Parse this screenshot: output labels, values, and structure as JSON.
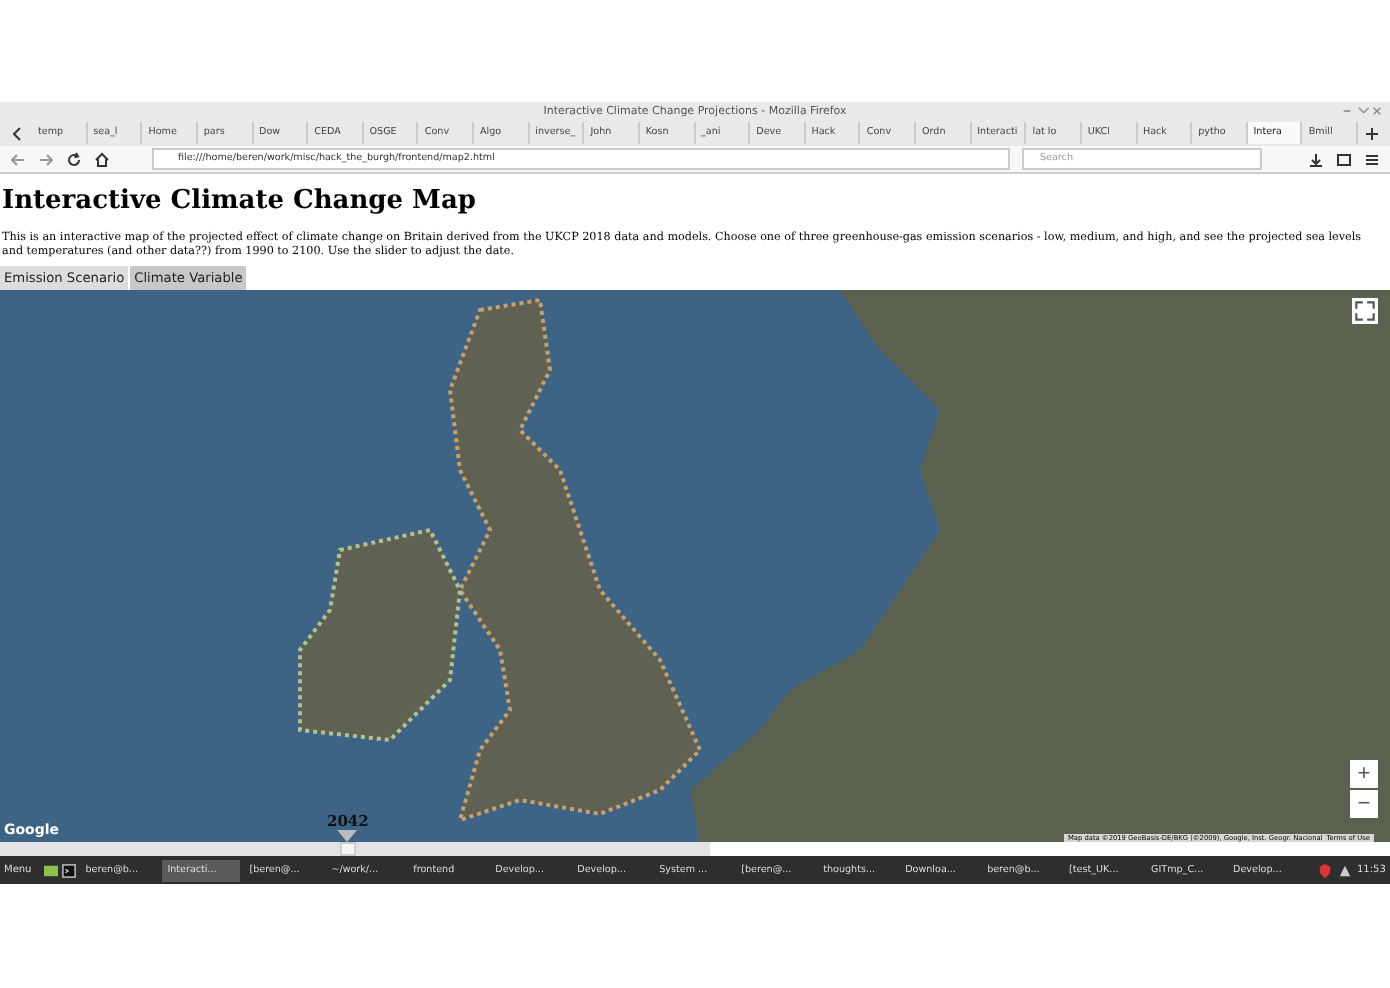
{
  "window": {
    "title": "Interactive Climate Change Projections - Mozilla Firefox"
  },
  "browser_tabs": [
    {
      "label": "temp",
      "selected": false
    },
    {
      "label": "sea_l",
      "selected": false
    },
    {
      "label": "Home",
      "selected": false
    },
    {
      "label": "pars",
      "selected": false
    },
    {
      "label": "Dow",
      "selected": false
    },
    {
      "label": "CEDA",
      "selected": false
    },
    {
      "label": "OSGE",
      "selected": false
    },
    {
      "label": "Conv",
      "selected": false
    },
    {
      "label": "Algo",
      "selected": false
    },
    {
      "label": "inverse_",
      "selected": false
    },
    {
      "label": "John",
      "selected": false
    },
    {
      "label": "Kosn",
      "selected": false
    },
    {
      "label": "_ani",
      "selected": false
    },
    {
      "label": "Deve",
      "selected": false
    },
    {
      "label": "Hack",
      "selected": false
    },
    {
      "label": "Conv",
      "selected": false
    },
    {
      "label": "Ordn",
      "selected": false
    },
    {
      "label": "Interacti",
      "selected": false
    },
    {
      "label": "lat lo",
      "selected": false
    },
    {
      "label": "UKCl",
      "selected": false
    },
    {
      "label": "Hack",
      "selected": false
    },
    {
      "label": "pytho",
      "selected": false
    },
    {
      "label": "Intera",
      "selected": true
    },
    {
      "label": "Bmill",
      "selected": false
    }
  ],
  "address_bar": {
    "url": "file:///home/beren/work/misc/hack_the_burgh/frontend/map2.html"
  },
  "search": {
    "placeholder": "Search"
  },
  "page": {
    "heading": "Interactive Climate Change Map",
    "intro": "This is an interactive map of the projected effect of climate change on Britain derived from the UKCP 2018 data and models. Choose one of three greenhouse-gas emission scenarios - low, medium, and high, and see the projected sea levels and temperatures (and other data??) from 1990 to 2100. Use the slider to adjust the date.",
    "tabs": [
      {
        "label": "Emission Scenario",
        "selected": false
      },
      {
        "label": "Climate Variable",
        "selected": true
      }
    ]
  },
  "map": {
    "logo": "Google",
    "attribution": "Map data ©2019 GeoBasis-DE/BKG (©2009), Google, Inst. Geogr. Nacional",
    "terms": "Terms of Use",
    "zoom_in": "+",
    "zoom_out": "−"
  },
  "slider": {
    "year": "2042",
    "level": 0.49
  },
  "taskbar": {
    "menu": "Menu",
    "clock": "11:53",
    "items": [
      {
        "label": "beren@b...",
        "selected": false
      },
      {
        "label": "Interacti...",
        "selected": true
      },
      {
        "label": "[beren@...",
        "selected": false
      },
      {
        "label": "~/work/...",
        "selected": false
      },
      {
        "label": "frontend",
        "selected": false
      },
      {
        "label": "Develop...",
        "selected": false
      },
      {
        "label": "Develop...",
        "selected": false
      },
      {
        "label": "System ...",
        "selected": false
      },
      {
        "label": "[beren@...",
        "selected": false
      },
      {
        "label": "thoughts...",
        "selected": false
      },
      {
        "label": "Downloa...",
        "selected": false
      },
      {
        "label": "beren@b...",
        "selected": false
      },
      {
        "label": "[test_UK...",
        "selected": false
      },
      {
        "label": "GITmp_C...",
        "selected": false
      },
      {
        "label": "Develop...",
        "selected": false
      }
    ]
  }
}
